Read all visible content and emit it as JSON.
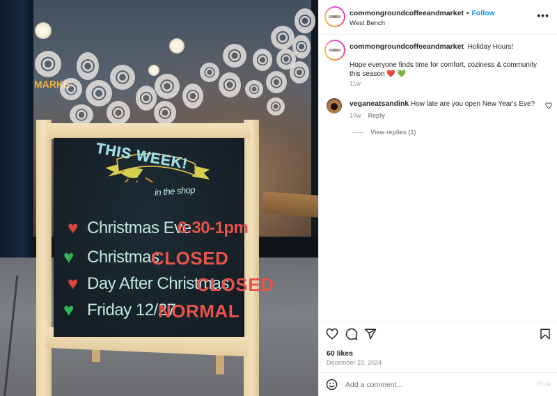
{
  "post": {
    "author": "commongroundcoffeeandmarket",
    "follow_label": "Follow",
    "separator": "•",
    "location": "West Bench",
    "more_icon": "more-horizontal-icon",
    "more_label": "•••",
    "caption": {
      "username": "commongroundcoffeeandmarket",
      "title": "Holiday Hours!",
      "body": "Hope everyone finds time for comfort, coziness & community this season ❤️ 💚",
      "time": "11w"
    },
    "comments": [
      {
        "username": "veganeatsandink",
        "text": "How late are you open New Year's Eve?",
        "time": "10w",
        "reply_label": "Reply",
        "view_replies_label": "View replies (1)"
      }
    ],
    "likes_label": "60 likes",
    "date": "December 23, 2024",
    "actions": [
      "heart-icon",
      "comment-icon",
      "share-icon",
      "bookmark-icon"
    ],
    "add_comment_placeholder": "Add a comment...",
    "post_button_label": "Post",
    "accent_color": "#0095f6"
  },
  "photo": {
    "alt": "Chalkboard sidewalk sign in front of a coffee shop window decorated with paper snowflakes",
    "window_sign_fragment": "MARKE",
    "sign": {
      "banner_title": "THIS WEEK!",
      "banner_subtitle": "in the shop",
      "lines": [
        {
          "heart_color": "#d9453d",
          "label": "Christmas Eve",
          "value": "6:30-1pm"
        },
        {
          "heart_color": "#2fb55a",
          "label": "Christmas",
          "value": "CLOSED"
        },
        {
          "heart_color": "#d9453d",
          "label": "Day After Christmas",
          "value": "CLOSED"
        },
        {
          "heart_color": "#2fb55a",
          "label": "Friday 12/27",
          "value": "NORMAL"
        }
      ]
    }
  }
}
